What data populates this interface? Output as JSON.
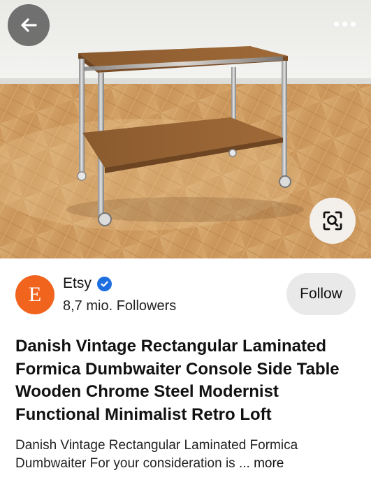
{
  "hero": {
    "image_alt": "Chrome and wood serving trolley on herringbone parquet floor"
  },
  "toolbar": {
    "back_icon": "arrow-left-icon",
    "more_icon": "ellipsis-icon",
    "lens_icon": "visual-search-icon"
  },
  "creator": {
    "avatar_letter": "E",
    "avatar_color": "#f1641e",
    "name": "Etsy",
    "verified_icon": "verified-badge-icon",
    "followers": "8,7 mio. Followers",
    "follow_label": "Follow"
  },
  "pin": {
    "title": "Danish Vintage Rectangular Laminated Formica Dumbwaiter Console Side Table Wooden Chrome Steel Modernist Functional Minimalist Retro Loft",
    "description": "Danish Vintage Rectangular Laminated Formica Dumbwaiter For your consideration is ... ",
    "more_label": "more"
  }
}
